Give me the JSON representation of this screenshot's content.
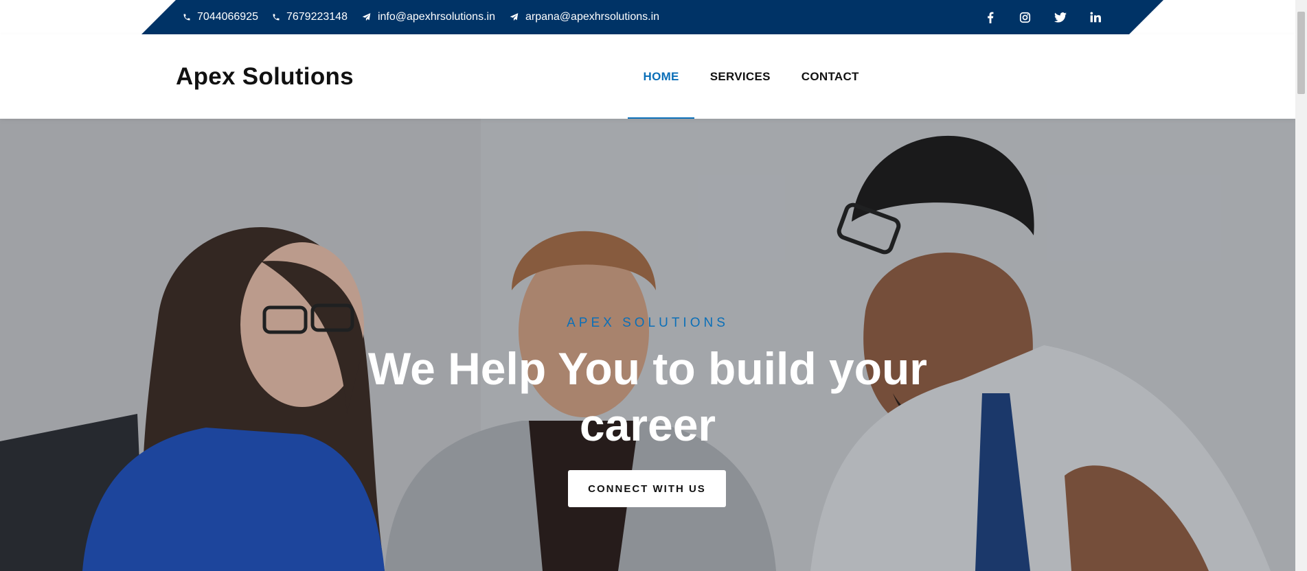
{
  "topbar": {
    "contacts": [
      {
        "icon": "phone-icon",
        "text": "7044066925"
      },
      {
        "icon": "phone-icon",
        "text": "7679223148"
      },
      {
        "icon": "paper-plane-icon",
        "text": "info@apexhrsolutions.in"
      },
      {
        "icon": "paper-plane-icon",
        "text": "arpana@apexhrsolutions.in"
      }
    ],
    "socials": [
      "facebook-icon",
      "instagram-icon",
      "twitter-icon",
      "linkedin-icon"
    ],
    "background": "#003366"
  },
  "header": {
    "logo": "Apex Solutions",
    "nav": [
      {
        "label": "HOME",
        "active": true
      },
      {
        "label": "SERVICES",
        "active": false
      },
      {
        "label": "CONTACT",
        "active": false
      }
    ],
    "accent": "#0b6fb8"
  },
  "hero": {
    "subtitle": "APEX SOLUTIONS",
    "title": "We Help You to build your career",
    "button": "CONNECT WITH US"
  }
}
